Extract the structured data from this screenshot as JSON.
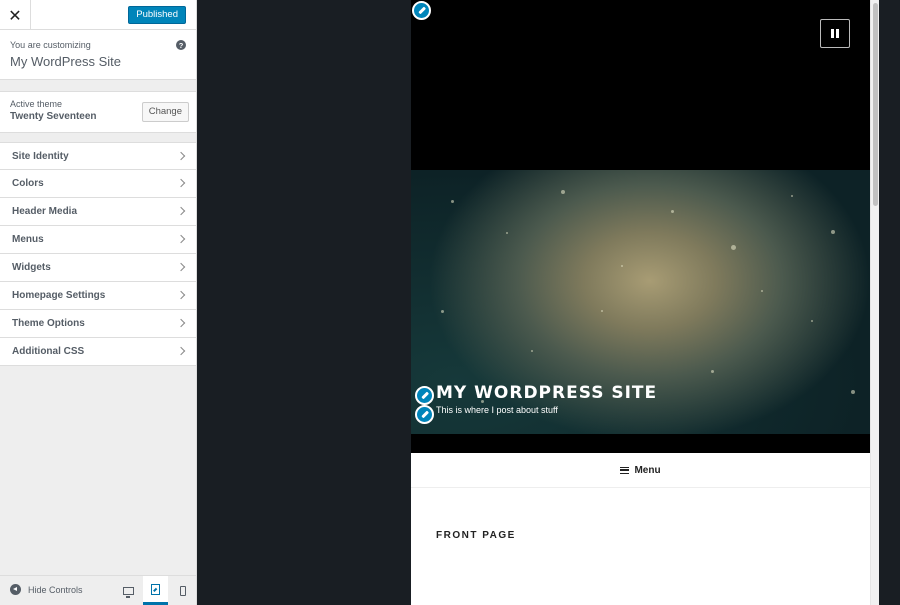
{
  "sidebar": {
    "close_glyph": "✕",
    "publish_label": "Published",
    "info_label": "You are customizing",
    "site_title": "My WordPress Site",
    "help_glyph": "?",
    "theme": {
      "label": "Active theme",
      "name": "Twenty Seventeen",
      "change_label": "Change"
    },
    "sections": [
      {
        "label": "Site Identity"
      },
      {
        "label": "Colors"
      },
      {
        "label": "Header Media"
      },
      {
        "label": "Menus"
      },
      {
        "label": "Widgets"
      },
      {
        "label": "Homepage Settings"
      },
      {
        "label": "Theme Options"
      },
      {
        "label": "Additional CSS"
      }
    ],
    "footer": {
      "hide_controls_label": "Hide Controls",
      "devices": [
        "desktop",
        "tablet",
        "mobile"
      ],
      "active_device": "tablet"
    }
  },
  "preview": {
    "site_name": "MY WORDPRESS SITE",
    "tagline": "This is where I post about stuff",
    "menu_label": "Menu",
    "front_page_title": "FRONT PAGE"
  },
  "colors": {
    "accent": "#0085ba",
    "sidebar_bg": "#eeeeee",
    "dark_bg": "#191e23"
  },
  "icons": [
    "close-icon",
    "help-icon",
    "chevron-right-icon",
    "collapse-icon",
    "desktop-icon",
    "tablet-icon",
    "mobile-icon",
    "pencil-icon",
    "menu-icon",
    "pause-icon"
  ]
}
